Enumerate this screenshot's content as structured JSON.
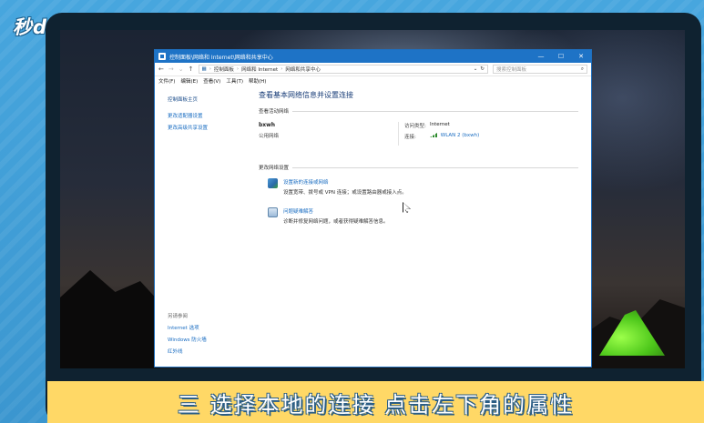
{
  "branding": {
    "logo_text": "秒dōng视频"
  },
  "caption": {
    "text": "三  选择本地的连接  点击左下角的属性"
  },
  "window": {
    "title": "控制面板\\网络和 Internet\\网络和共享中心",
    "controls": {
      "minimize": "—",
      "maximize": "☐",
      "close": "✕"
    },
    "address": {
      "crumbs": [
        "控制面板",
        "网络和 Internet",
        "网络和共享中心"
      ],
      "search_placeholder": "搜索控制面板"
    },
    "menu": [
      "文件(F)",
      "编辑(E)",
      "查看(V)",
      "工具(T)",
      "帮助(H)"
    ]
  },
  "sidebar": {
    "home": "控制面板主页",
    "links": [
      "更改适配器设置",
      "更改高级共享设置"
    ],
    "see_also_label": "另请参阅",
    "see_also": [
      "Internet 选项",
      "Windows 防火墙",
      "红外线"
    ]
  },
  "main": {
    "heading": "查看基本网络信息并设置连接",
    "active_section": "查看活动网络",
    "network": {
      "name": "bxwh",
      "type": "公用网络",
      "access_type_label": "访问类型:",
      "access_type_value": "Internet",
      "connection_label": "连接:",
      "connection_value": "WLAN 2 (bxwh)"
    },
    "change_section": "更改网络设置",
    "tasks": [
      {
        "title": "设置新的连接或网络",
        "desc": "设置宽带、拨号或 VPN 连接；或设置路由器或接入点。"
      },
      {
        "title": "问题疑难解答",
        "desc": "诊断并修复网络问题，或者获得疑难解答信息。"
      }
    ]
  }
}
